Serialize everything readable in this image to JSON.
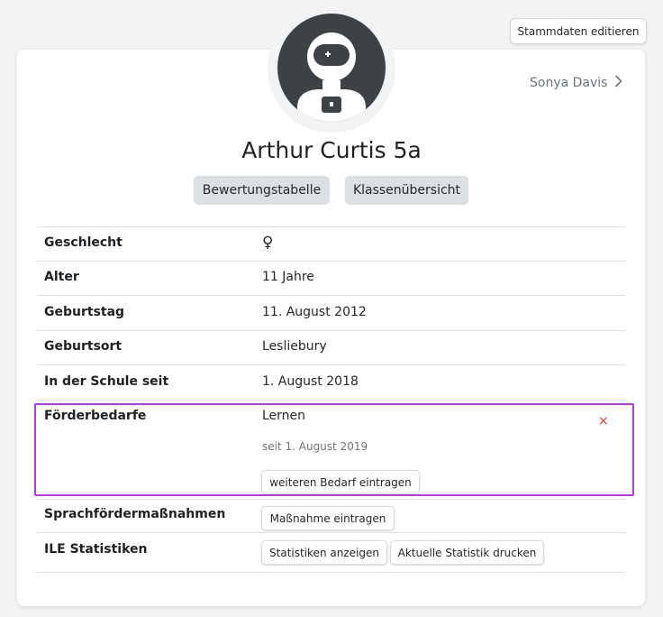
{
  "header": {
    "edit_button": "Stammdaten editieren"
  },
  "teacher": {
    "name": "Sonya Davis"
  },
  "student": {
    "title": "Arthur Curtis 5a"
  },
  "actions": {
    "rating_table": "Bewertungstabelle",
    "class_overview": "Klassenübersicht"
  },
  "rows": [
    {
      "label": "Geschlecht",
      "value": "♀"
    },
    {
      "label": "Alter",
      "value": "11 Jahre"
    },
    {
      "label": "Geburtstag",
      "value": "11. August 2012"
    },
    {
      "label": "Geburtsort",
      "value": "Lesliebury"
    },
    {
      "label": "In der Schule seit",
      "value": "1. August 2018"
    }
  ],
  "support": {
    "label": "Förderbedarfe",
    "need": "Lernen",
    "since": "seit 1. August 2019",
    "add_button": "weiteren Bedarf eintragen",
    "remove_symbol": "×"
  },
  "language": {
    "label": "Sprachfördermaßnahmen",
    "button": "Maßnahme eintragen"
  },
  "stats": {
    "label": "ILE Statistiken",
    "show_button": "Statistiken anzeigen",
    "print_button": "Aktuelle Statistik drucken"
  },
  "colors": {
    "highlight": "#b43dd6",
    "remove": "#d33b3b",
    "avatar_bg": "#3e4245"
  }
}
